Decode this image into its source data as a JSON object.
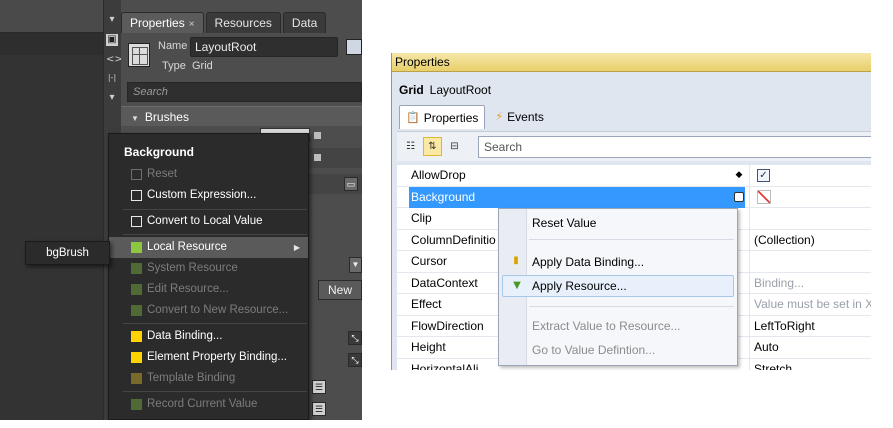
{
  "blend": {
    "tabs": [
      {
        "label": "Properties",
        "close": "×"
      },
      {
        "label": "Resources"
      },
      {
        "label": "Data"
      }
    ],
    "name_label": "Name",
    "name_value": "LayoutRoot",
    "type_label": "Type",
    "type_value": "Grid",
    "search_placeholder": "Search",
    "section": "Brushes",
    "new_button": "New",
    "menu": {
      "title": "Background",
      "items": [
        {
          "label": "Reset",
          "disabled": true,
          "marker": "box"
        },
        {
          "label": "Custom Expression...",
          "disabled": false,
          "marker": "box"
        },
        {
          "label": "Convert to Local Value",
          "disabled": false,
          "marker": "box"
        },
        {
          "label": "Local Resource",
          "disabled": false,
          "marker": "green",
          "highlighted": true,
          "submenu": true
        },
        {
          "label": "System Resource",
          "disabled": true,
          "marker": "green"
        },
        {
          "label": "Edit Resource...",
          "disabled": true,
          "marker": "green"
        },
        {
          "label": "Convert to New Resource...",
          "disabled": true,
          "marker": "green"
        },
        {
          "label": "Data Binding...",
          "disabled": false,
          "marker": "yellow"
        },
        {
          "label": "Element Property Binding...",
          "disabled": false,
          "marker": "yellow"
        },
        {
          "label": "Template Binding",
          "disabled": true,
          "marker": "yellow"
        },
        {
          "label": "Record Current Value",
          "disabled": true,
          "marker": "green"
        }
      ]
    },
    "flyout_item": "bgBrush",
    "colors": {
      "green": "#8dc63f",
      "green_disabled": "#4f6a35",
      "yellow": "#ffd200",
      "yellow_disabled": "#7a6a2a"
    }
  },
  "vs": {
    "title": "Properties",
    "type_name": "Grid",
    "object_name": "LayoutRoot",
    "tabs": [
      {
        "label": "Properties",
        "icon": "properties-icon"
      },
      {
        "label": "Events",
        "icon": "lightning-icon"
      }
    ],
    "search_placeholder": "Search",
    "properties": [
      {
        "name": "AllowDrop",
        "value": "",
        "marker": "diamond",
        "check": true
      },
      {
        "name": "Background",
        "value": "",
        "marker": "box",
        "selected": true,
        "nobrush": true
      },
      {
        "name": "Clip",
        "value": ""
      },
      {
        "name": "ColumnDefinitio",
        "value": "(Collection)"
      },
      {
        "name": "Cursor",
        "value": ""
      },
      {
        "name": "DataContext",
        "value": "Binding...",
        "muted": true
      },
      {
        "name": "Effect",
        "value": "Value must be set in XA",
        "muted": true
      },
      {
        "name": "FlowDirection",
        "value": "LeftToRight"
      },
      {
        "name": "Height",
        "value": "Auto"
      },
      {
        "name": "HorizontalAli",
        "value": "Stretch"
      }
    ],
    "menu": {
      "items": [
        {
          "label": "Reset Value",
          "disabled": false
        },
        {
          "label": "Apply Data Binding...",
          "disabled": false,
          "icon": "databinding-icon"
        },
        {
          "label": "Apply Resource...",
          "disabled": false,
          "icon": "resource-icon",
          "highlighted": true
        },
        {
          "label": "Extract Value to Resource...",
          "disabled": true
        },
        {
          "label": "Go to Value Defintion...",
          "disabled": true
        }
      ]
    },
    "colors": {
      "selection": "#3399ff",
      "title_bar": "#f0d97a"
    }
  }
}
